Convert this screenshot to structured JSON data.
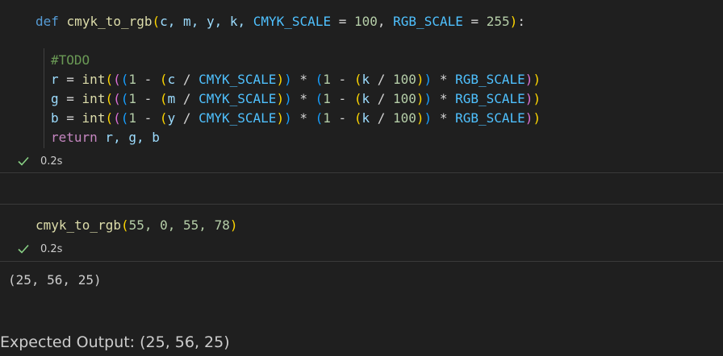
{
  "cell1": {
    "code": {
      "def": "def",
      "fn_name": "cmyk_to_rgb",
      "params": "c, m, y, k, ",
      "cmyk_param": "CMYK_SCALE",
      "eq1": " = ",
      "cmyk_default": "100",
      "comma": ", ",
      "rgb_param": "RGB_SCALE",
      "eq2": " = ",
      "rgb_default": "255",
      "end": ":",
      "todo": "#TODO",
      "line_r": {
        "var": "r",
        "ch": "c"
      },
      "line_g": {
        "var": "g",
        "ch": "m"
      },
      "line_b": {
        "var": "b",
        "ch": "y"
      },
      "return_kw": "return",
      "return_vals": " r, g, b"
    },
    "exec_time": "0.2s"
  },
  "cell2": {
    "code": {
      "fn_name": "cmyk_to_rgb",
      "args": "55, 0, 55, 78"
    },
    "exec_time": "0.2s"
  },
  "output": "(25, 56, 25)",
  "expected": "Expected Output: (25, 56, 25)",
  "colors": {
    "background": "#1f1f1f",
    "keyword": "#569cd6",
    "function": "#dcdcaa",
    "variable": "#9cdcfe",
    "constant": "#4fc1ff",
    "number": "#b5cea8",
    "comment": "#6a9955",
    "return": "#c586c0",
    "check": "#89d185"
  }
}
